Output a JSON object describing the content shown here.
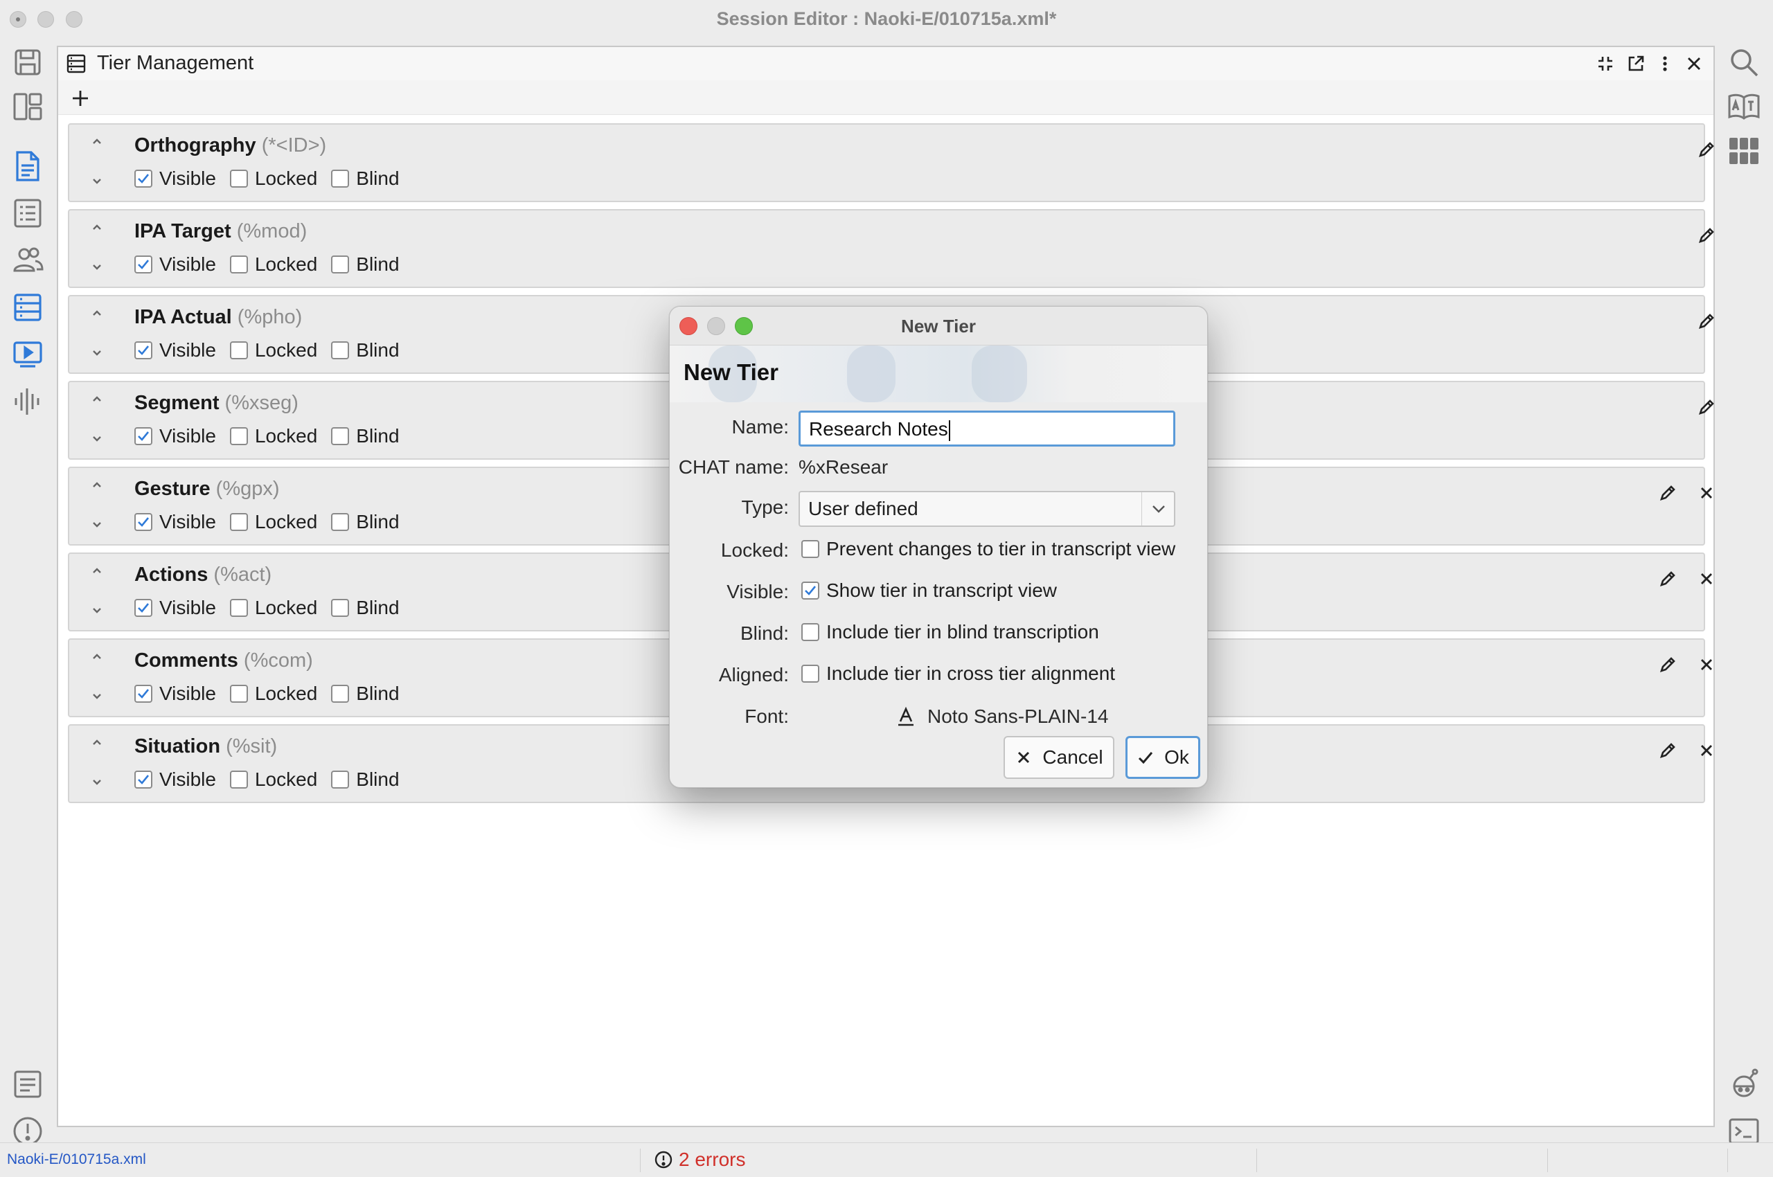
{
  "window": {
    "title": "Session Editor : Naoki-E/010715a.xml*"
  },
  "panel": {
    "title": "Tier Management"
  },
  "tier_options": {
    "visible": "Visible",
    "locked": "Locked",
    "blind": "Blind"
  },
  "tiers": [
    {
      "name": "Orthography",
      "code": "(*<ID>)",
      "visible": true,
      "locked": false,
      "blind": false,
      "deletable": false
    },
    {
      "name": "IPA Target",
      "code": "(%mod)",
      "visible": true,
      "locked": false,
      "blind": false,
      "deletable": false
    },
    {
      "name": "IPA Actual",
      "code": "(%pho)",
      "visible": true,
      "locked": false,
      "blind": false,
      "deletable": false
    },
    {
      "name": "Segment",
      "code": "(%xseg)",
      "visible": true,
      "locked": false,
      "blind": false,
      "deletable": false
    },
    {
      "name": "Gesture",
      "code": "(%gpx)",
      "visible": true,
      "locked": false,
      "blind": false,
      "deletable": true
    },
    {
      "name": "Actions",
      "code": "(%act)",
      "visible": true,
      "locked": false,
      "blind": false,
      "deletable": true
    },
    {
      "name": "Comments",
      "code": "(%com)",
      "visible": true,
      "locked": false,
      "blind": false,
      "deletable": true
    },
    {
      "name": "Situation",
      "code": "(%sit)",
      "visible": true,
      "locked": false,
      "blind": false,
      "deletable": true
    }
  ],
  "dialog": {
    "window_title": "New Tier",
    "header": "New Tier",
    "name_label": "Name:",
    "name_value": "Research Notes",
    "chat_label": "CHAT name:",
    "chat_value": "%xResear",
    "type_label": "Type:",
    "type_value": "User defined",
    "locked_label": "Locked:",
    "locked_text": "Prevent changes to tier in transcript view",
    "locked_checked": false,
    "visible_label": "Visible:",
    "visible_text": "Show tier in transcript view",
    "visible_checked": true,
    "blind_label": "Blind:",
    "blind_text": "Include tier in blind transcription",
    "blind_checked": false,
    "aligned_label": "Aligned:",
    "aligned_text": "Include tier in cross tier alignment",
    "aligned_checked": false,
    "font_label": "Font:",
    "font_value": "Noto Sans-PLAIN-14",
    "cancel_label": "Cancel",
    "ok_label": "Ok"
  },
  "status": {
    "file": "Naoki-E/010715a.xml",
    "errors": "2 errors"
  },
  "colors": {
    "accent": "#5a9ad8",
    "sidebar_active": "#2f7ad8",
    "error": "#d0302a",
    "link": "#2457c5"
  }
}
